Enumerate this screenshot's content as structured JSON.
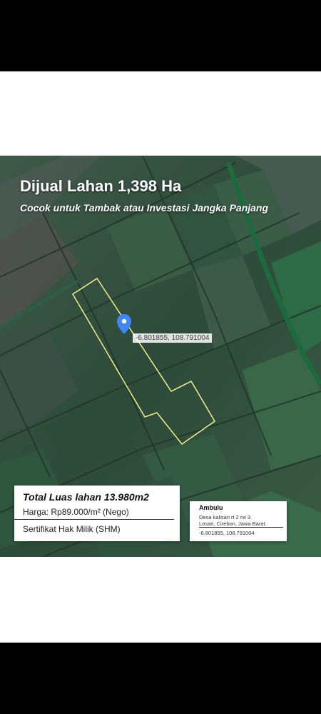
{
  "headline": {
    "title": "Dijual Lahan 1,398 Ha",
    "subtitle": "Cocok untuk Tambak atau Investasi Jangka Panjang"
  },
  "map": {
    "pin_coordinates": "-6.801855, 108.791004",
    "pin_color": "#4285f4",
    "boundary_color": "#f2f08a",
    "pin_icon": "location-pin-icon"
  },
  "info_card": {
    "total_area": "Total Luas lahan 13.980m2",
    "price": "Harga: Rp89.000/m² (Nego)",
    "certificate": "Sertifikat Hak Milik (SHM)"
  },
  "location_card": {
    "name": "Ambulu",
    "address_line1": "Desa kalisari rt 2 rw 3.",
    "address_line2": "Losari, Cirebon, Jawa Barat.",
    "coordinates": "-6.801855, 108.791004"
  }
}
